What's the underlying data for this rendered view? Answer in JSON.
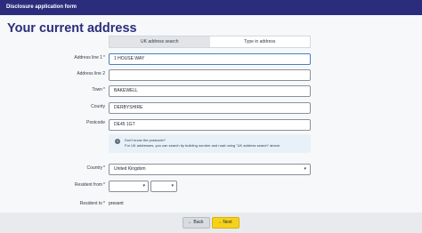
{
  "app": {
    "title": "Disclosure application form"
  },
  "page": {
    "heading": "Your current address"
  },
  "tabs": [
    {
      "label": "UK address search",
      "active": false
    },
    {
      "label": "Type in address",
      "active": true
    }
  ],
  "form": {
    "address_line1": {
      "label": "Address line 1",
      "required": "*",
      "value": "1 HOUSE WAY"
    },
    "address_line2": {
      "label": "Address line 2",
      "required": "",
      "value": ""
    },
    "town": {
      "label": "Town",
      "required": "*",
      "value": "BAKEWELL"
    },
    "county": {
      "label": "County",
      "required": "",
      "value": "DERBYSHIRE"
    },
    "postcode": {
      "label": "Postcode",
      "required": "",
      "value": "DE45 1GT"
    },
    "info": {
      "title": "Don't know the postcode?",
      "text": "For UK addresses, you can search by building number and road using \"UK address search\" above."
    },
    "country": {
      "label": "Country",
      "required": "*",
      "value": "United Kingdom"
    },
    "resident_from": {
      "label": "Resident from",
      "required": "*",
      "month": "",
      "year": ""
    },
    "resident_to": {
      "label": "Resident to",
      "required": "*",
      "value": "present"
    }
  },
  "buttons": {
    "back": "Back",
    "next": "Next"
  },
  "icons": {
    "info": "info-icon",
    "back": "arrow-left-icon",
    "next": "arrow-right-icon",
    "dropdown": "chevron-down-icon"
  },
  "colors": {
    "header_bg": "#2b2d7c",
    "heading": "#2b2d7c",
    "next_button": "#f7d21b",
    "info_bg": "#e9f1f8"
  }
}
